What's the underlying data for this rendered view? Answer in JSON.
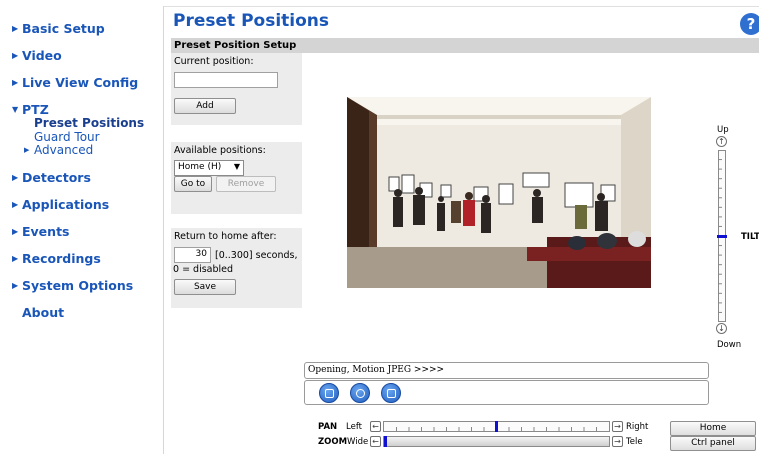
{
  "nav": {
    "basic_setup": "Basic Setup",
    "video": "Video",
    "live_view_config": "Live View Config",
    "ptz": "PTZ",
    "ptz_sub": {
      "preset_positions": "Preset Positions",
      "guard_tour": "Guard Tour",
      "advanced": "Advanced"
    },
    "detectors": "Detectors",
    "applications": "Applications",
    "events": "Events",
    "recordings": "Recordings",
    "system_options": "System Options",
    "about": "About"
  },
  "header": {
    "title": "Preset Positions",
    "help": "?"
  },
  "section": {
    "title": "Preset Position Setup"
  },
  "current_position": {
    "label": "Current position:",
    "value": "",
    "add_button": "Add"
  },
  "available_positions": {
    "label": "Available positions:",
    "selected": "Home (H)",
    "goto_button": "Go to",
    "remove_button": "Remove"
  },
  "return_home": {
    "label": "Return to home after:",
    "value": "30",
    "range_text": "[0..300] seconds,",
    "note": "0 = disabled",
    "save_button": "Save"
  },
  "tilt": {
    "up": "Up",
    "down": "Down",
    "label": "TILT",
    "position_fraction": 0.5
  },
  "status": {
    "text": "Opening, Motion JPEG >>>>"
  },
  "pan": {
    "label": "PAN",
    "left": "Left",
    "right": "Right",
    "position_fraction": 0.5
  },
  "zoom": {
    "label": "ZOOM",
    "wide": "Wide",
    "tele": "Tele",
    "position_fraction": 0.0
  },
  "buttons": {
    "home": "Home",
    "ctrl_panel": "Ctrl panel"
  },
  "colors": {
    "link": "#1a56b8",
    "accent": "#1010d0",
    "section_bar": "#d4d4d4"
  }
}
